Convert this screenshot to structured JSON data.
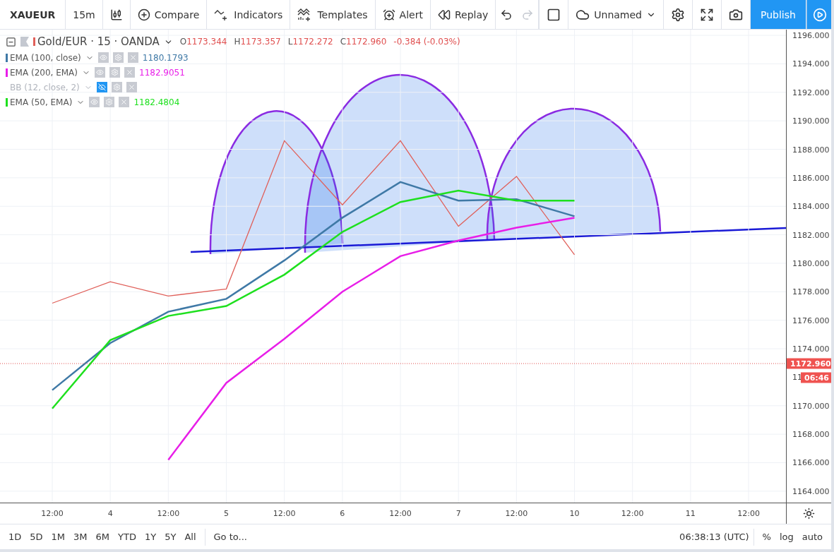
{
  "toolbar": {
    "symbol": "XAUEUR",
    "interval": "15m",
    "buttons": [
      {
        "kind": "compare",
        "label": "Compare"
      },
      {
        "kind": "indicators",
        "label": "Indicators"
      },
      {
        "kind": "templates",
        "label": "Templates"
      },
      {
        "kind": "alert",
        "label": "Alert"
      },
      {
        "kind": "replay",
        "label": "Replay"
      }
    ],
    "history": [
      {
        "kind": "undo",
        "disabled": false
      },
      {
        "kind": "redo",
        "disabled": true
      }
    ],
    "layout_name": "Unnamed",
    "publish": "Publish"
  },
  "legend": {
    "ohlc": [
      {
        "label": "O",
        "value": "1173.344"
      },
      {
        "label": "H",
        "value": "1173.357"
      },
      {
        "label": "L",
        "value": "1172.272"
      },
      {
        "label": "C",
        "value": "1172.960"
      }
    ],
    "change": "-0.384 (-0.03%)",
    "indicators": [
      {
        "kind": "series",
        "value": "1180.1793",
        "hidden": false
      },
      {
        "kind": "series",
        "value": "1182.9051",
        "hidden": false
      },
      {
        "kind": "study",
        "name": "BB (12, close, 2)",
        "hidden": true
      },
      {
        "kind": "series",
        "value": "1182.4804",
        "hidden": false
      }
    ]
  },
  "chart_data": {
    "type": "line",
    "categories": [
      "12:00",
      "4",
      "12:00",
      "5",
      "12:00",
      "6",
      "12:00",
      "7",
      "12:00",
      "10",
      "12:00",
      "11",
      "12:00"
    ],
    "series": [
      {
        "name": "Gold/EUR · 15 · OANDA",
        "color": "#e0605a",
        "values": [
          1177.2,
          1178.7,
          1177.7,
          1178.2,
          1188.6,
          1184.1,
          1188.6,
          1182.6,
          1186.1,
          1180.6,
          null,
          null,
          null
        ]
      },
      {
        "name": "EMA (100, close)",
        "color": "#3f79a6",
        "values": [
          1171.1,
          1174.4,
          1176.6,
          1177.5,
          1180.2,
          1183.2,
          1185.7,
          1184.4,
          1184.5,
          1183.3,
          null,
          null,
          null
        ]
      },
      {
        "name": "EMA (200, EMA)",
        "color": "#e81ee8",
        "values": [
          null,
          null,
          1166.2,
          1171.6,
          1174.7,
          1178.0,
          1180.5,
          1181.6,
          1182.5,
          1183.2,
          null,
          null,
          null
        ]
      },
      {
        "name": "EMA (50, EMA)",
        "color": "#1ee01e",
        "values": [
          1169.8,
          1174.6,
          1176.3,
          1177.0,
          1179.2,
          1182.2,
          1184.3,
          1185.1,
          1184.4,
          1184.4,
          null,
          null,
          null
        ]
      }
    ],
    "ylim": [
      1163.2,
      1196.4
    ],
    "grid": true,
    "legend": "upper left",
    "ref_lines": [
      {
        "axis": "y",
        "value": 1172.96,
        "label": "1172.960",
        "color": "#e05050"
      }
    ],
    "yticks": [
      {
        "value": 1164,
        "label": "1164.000"
      },
      {
        "value": 1166,
        "label": "1166.000"
      },
      {
        "value": 1168,
        "label": "1168.000"
      },
      {
        "value": 1170,
        "label": "1170.000"
      },
      {
        "value": 1174,
        "label": "1174.000"
      },
      {
        "value": 1176,
        "label": "1176.000"
      },
      {
        "value": 1178,
        "label": "1178.000"
      },
      {
        "value": 1180,
        "label": "1180.000"
      },
      {
        "value": 1182,
        "label": "1182.000"
      },
      {
        "value": 1184,
        "label": "1184.000"
      },
      {
        "value": 1186,
        "label": "1186.000"
      },
      {
        "value": 1188,
        "label": "1188.000"
      },
      {
        "value": 1190,
        "label": "1190.000"
      },
      {
        "value": 1192,
        "label": "1192.000"
      },
      {
        "value": 1194,
        "label": "1194.000"
      },
      {
        "value": 1196,
        "label": "1196.000"
      }
    ]
  },
  "price_axis": {
    "covered_label": "11",
    "countdown": "06:46"
  },
  "bottom_bar": {
    "ranges": [
      "1D",
      "5D",
      "1M",
      "3M",
      "6M",
      "YTD",
      "1Y",
      "5Y",
      "All"
    ],
    "goto": "Go to...",
    "clock": "06:38:13 (UTC)",
    "options": [
      "%",
      "log",
      "auto"
    ]
  }
}
